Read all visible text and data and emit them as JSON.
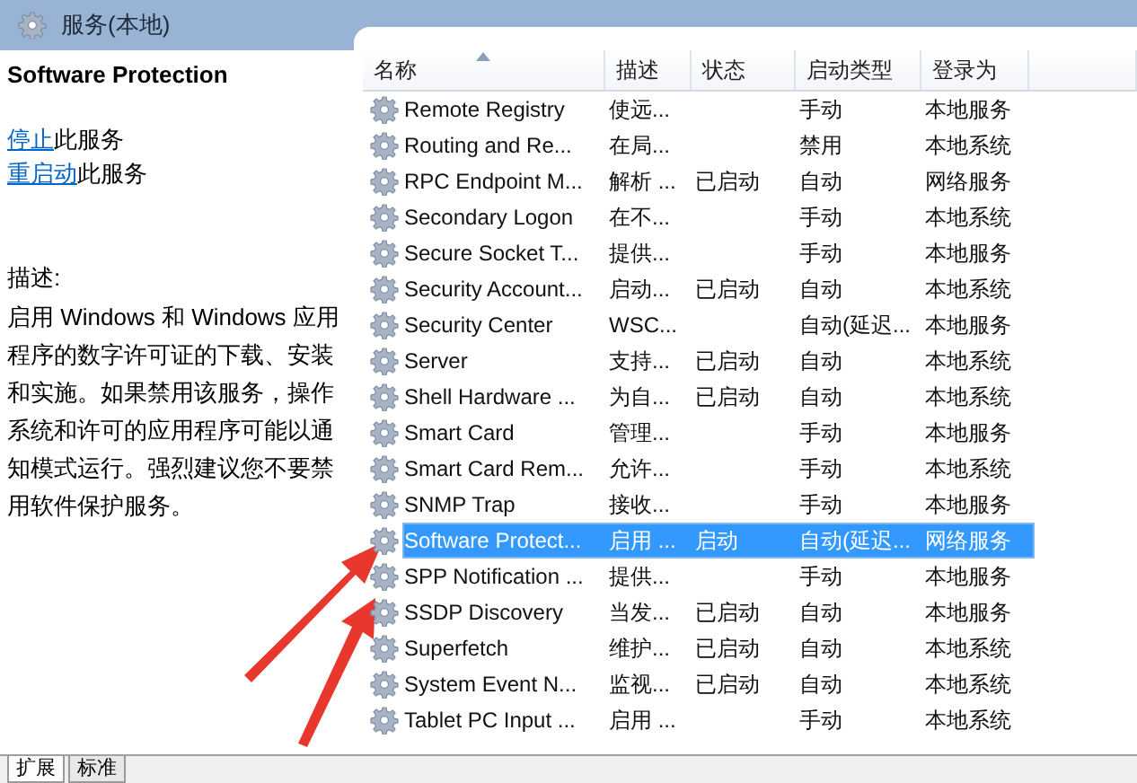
{
  "window": {
    "title": "服务(本地)"
  },
  "details": {
    "service_name": "Software Protection",
    "actions": [
      {
        "link": "停止",
        "text": "此服务"
      },
      {
        "link": "重启动",
        "text": "此服务"
      }
    ],
    "description_label": "描述:",
    "description": "启用 Windows 和 Windows 应用程序的数字许可证的下载、安装和实施。如果禁用该服务，操作系统和许可的应用程序可能以通知模式运行。强烈建议您不要禁用软件保护服务。"
  },
  "table": {
    "columns": [
      {
        "label": "名称",
        "sorted": true
      },
      {
        "label": "描述",
        "sorted": false
      },
      {
        "label": "状态",
        "sorted": false
      },
      {
        "label": "启动类型",
        "sorted": false
      },
      {
        "label": "登录为",
        "sorted": false
      }
    ],
    "rows": [
      {
        "name": "Remote Registry",
        "description": "使远...",
        "status": "",
        "startup": "手动",
        "logon": "本地服务",
        "selected": false
      },
      {
        "name": "Routing and Re...",
        "description": "在局...",
        "status": "",
        "startup": "禁用",
        "logon": "本地系统",
        "selected": false
      },
      {
        "name": "RPC Endpoint M...",
        "description": "解析 ...",
        "status": "已启动",
        "startup": "自动",
        "logon": "网络服务",
        "selected": false
      },
      {
        "name": "Secondary Logon",
        "description": "在不...",
        "status": "",
        "startup": "手动",
        "logon": "本地系统",
        "selected": false
      },
      {
        "name": "Secure Socket T...",
        "description": "提供...",
        "status": "",
        "startup": "手动",
        "logon": "本地服务",
        "selected": false
      },
      {
        "name": "Security Account...",
        "description": "启动...",
        "status": "已启动",
        "startup": "自动",
        "logon": "本地系统",
        "selected": false
      },
      {
        "name": "Security Center",
        "description": "WSC...",
        "status": "",
        "startup": "自动(延迟...",
        "logon": "本地服务",
        "selected": false
      },
      {
        "name": "Server",
        "description": "支持...",
        "status": "已启动",
        "startup": "自动",
        "logon": "本地系统",
        "selected": false
      },
      {
        "name": "Shell Hardware ...",
        "description": "为自...",
        "status": "已启动",
        "startup": "自动",
        "logon": "本地系统",
        "selected": false
      },
      {
        "name": "Smart Card",
        "description": "管理...",
        "status": "",
        "startup": "手动",
        "logon": "本地服务",
        "selected": false
      },
      {
        "name": "Smart Card Rem...",
        "description": "允许...",
        "status": "",
        "startup": "手动",
        "logon": "本地系统",
        "selected": false
      },
      {
        "name": "SNMP Trap",
        "description": "接收...",
        "status": "",
        "startup": "手动",
        "logon": "本地服务",
        "selected": false
      },
      {
        "name": "Software Protect...",
        "description": "启用 ...",
        "status": "启动",
        "startup": "自动(延迟...",
        "logon": "网络服务",
        "selected": true
      },
      {
        "name": "SPP Notification ...",
        "description": "提供...",
        "status": "",
        "startup": "手动",
        "logon": "本地服务",
        "selected": false
      },
      {
        "name": "SSDP Discovery",
        "description": "当发...",
        "status": "已启动",
        "startup": "自动",
        "logon": "本地服务",
        "selected": false
      },
      {
        "name": "Superfetch",
        "description": "维护...",
        "status": "已启动",
        "startup": "自动",
        "logon": "本地系统",
        "selected": false
      },
      {
        "name": "System Event N...",
        "description": "监视...",
        "status": "已启动",
        "startup": "自动",
        "logon": "本地系统",
        "selected": false
      },
      {
        "name": "Tablet PC Input ...",
        "description": "启用 ...",
        "status": "",
        "startup": "手动",
        "logon": "本地系统",
        "selected": false
      }
    ]
  },
  "bottom_tabs": [
    {
      "label": "扩展",
      "selected": true
    },
    {
      "label": "标准",
      "selected": false
    }
  ]
}
